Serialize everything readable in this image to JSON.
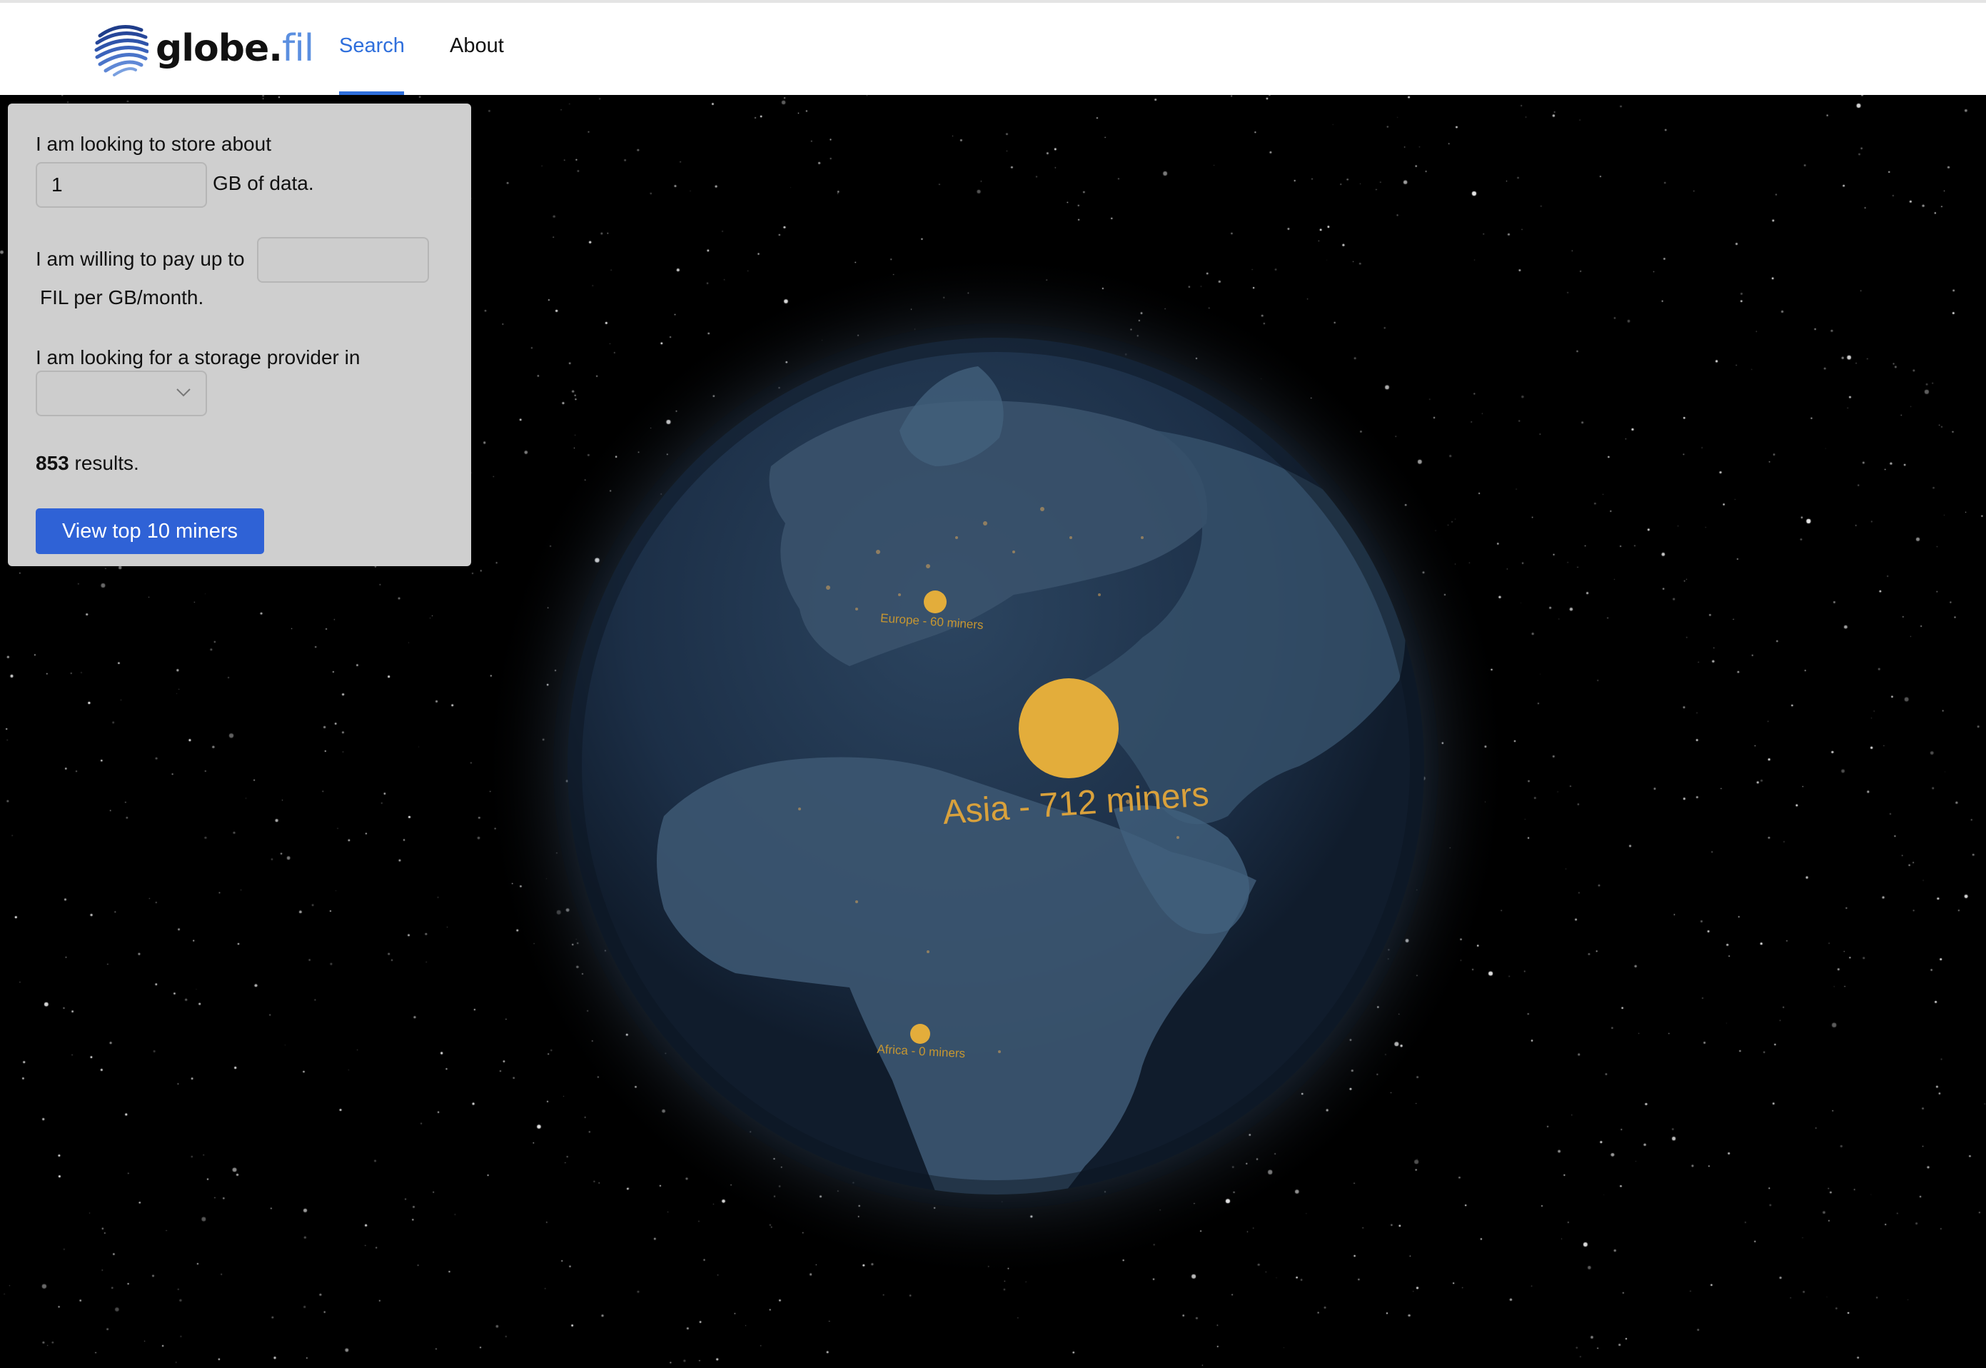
{
  "header": {
    "logo_name": "globe.",
    "logo_tld": "fil",
    "nav": {
      "search": "Search",
      "about": "About"
    }
  },
  "search_panel": {
    "store_prefix": "I am looking to store about",
    "store_value": "1",
    "store_suffix": "GB of data.",
    "pay_prefix": "I am willing to pay up to",
    "pay_value": "",
    "pay_suffix": "FIL per GB/month.",
    "region_prefix": "I am looking for a storage provider in",
    "region_selected": "",
    "results_count": "853",
    "results_suffix": "results.",
    "view_button": "View top 10 miners"
  },
  "globe": {
    "regions": [
      {
        "name": "Europe",
        "label": "Europe - 60 miners",
        "miners": 60
      },
      {
        "name": "Asia",
        "label": "Asia - 712 miners",
        "miners": 712
      },
      {
        "name": "Africa",
        "label": "Africa - 0 miners",
        "miners": 0
      }
    ]
  },
  "colors": {
    "accent": "#2f6fdc",
    "button": "#2f62d6",
    "marker": "#e3ad3b",
    "panel": "#cfcfcf",
    "ocean": "#1a2c42"
  },
  "icons": {
    "select_arrow": "chevron-down-icon",
    "logo": "globe-swirl-icon"
  }
}
